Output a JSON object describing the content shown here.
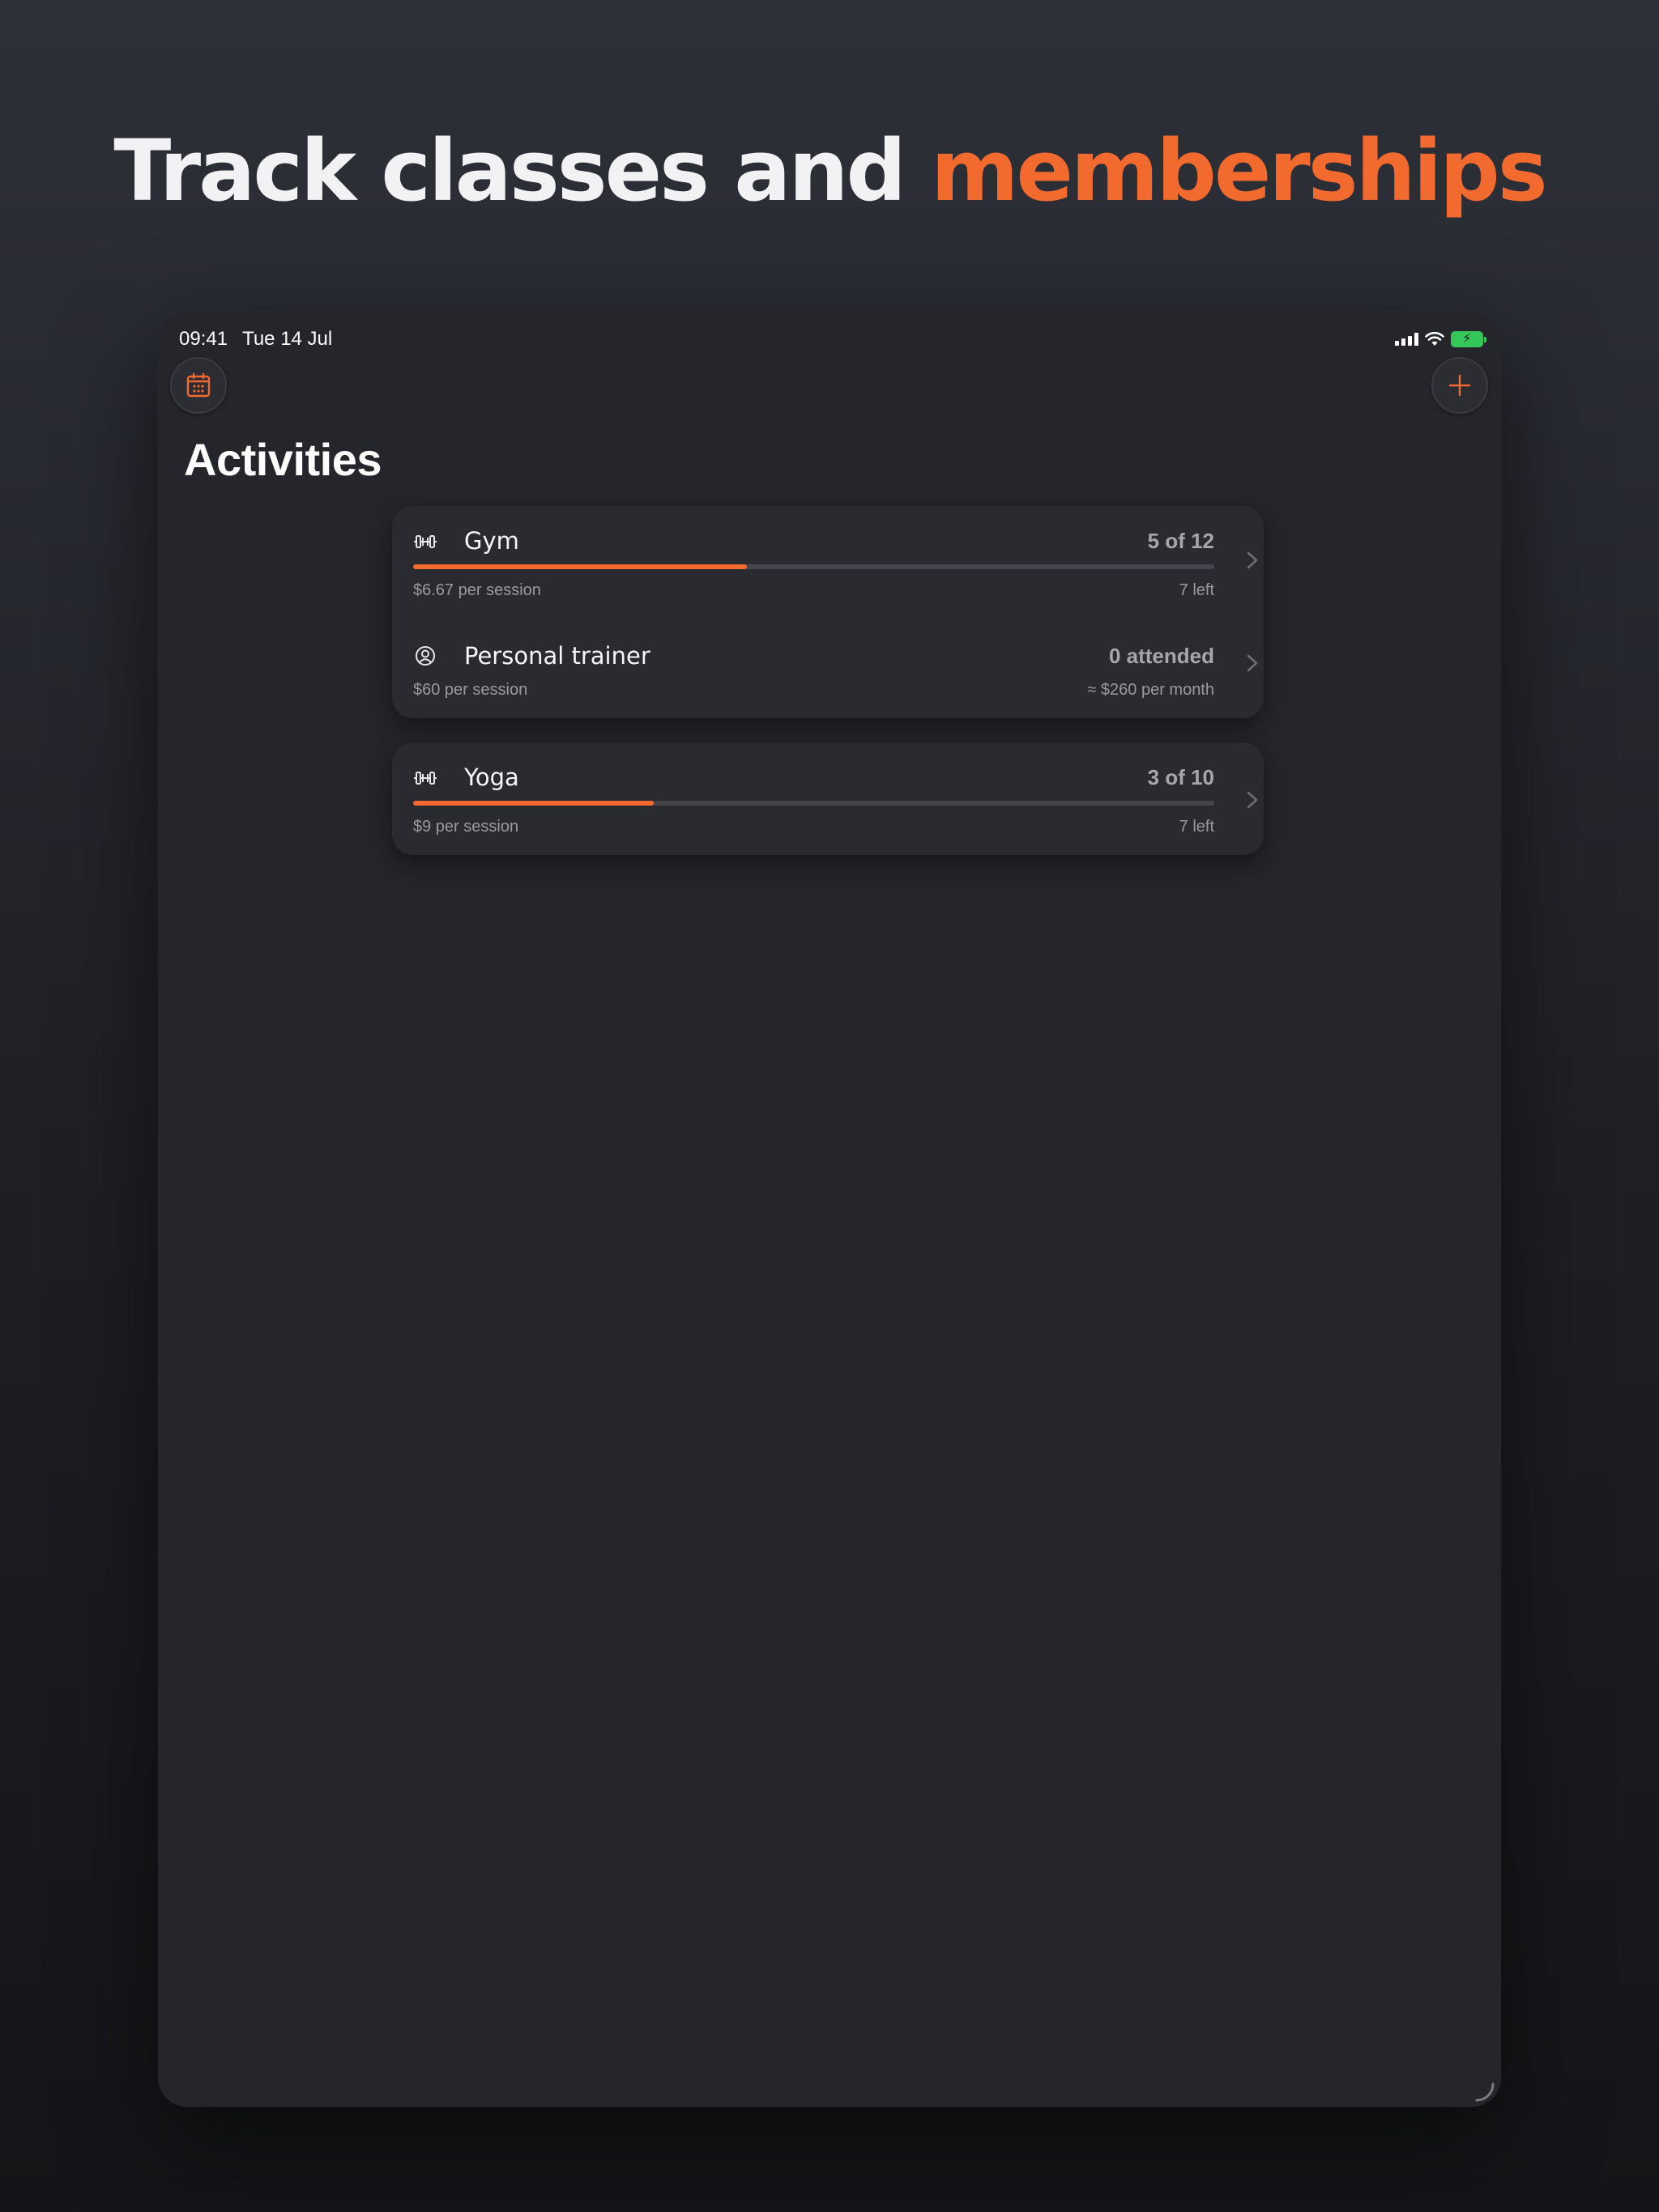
{
  "headline": {
    "text_main": "Track classes and",
    "text_accent": "memberships"
  },
  "status_bar": {
    "time": "09:41",
    "date": "Tue 14 Jul"
  },
  "toolbar": {
    "calendar_icon": "calendar-icon",
    "add_icon": "plus-icon"
  },
  "page": {
    "title": "Activities"
  },
  "colors": {
    "accent": "#f26a2e",
    "background": "#25262b",
    "card": "#2a2b30",
    "battery": "#34c759"
  },
  "groups": [
    {
      "items": [
        {
          "icon": "dumbbell-icon",
          "name": "Gym",
          "count": "5 of 12",
          "progress": 0.4167,
          "price": "$6.67 per session",
          "remaining": "7 left"
        },
        {
          "icon": "person-circle-icon",
          "name": "Personal trainer",
          "count": "0 attended",
          "price": "$60 per session",
          "remaining": "≈ $260 per month"
        }
      ]
    },
    {
      "items": [
        {
          "icon": "dumbbell-icon",
          "name": "Yoga",
          "count": "3 of 10",
          "progress": 0.3,
          "price": "$9 per session",
          "remaining": "7 left"
        }
      ]
    }
  ]
}
